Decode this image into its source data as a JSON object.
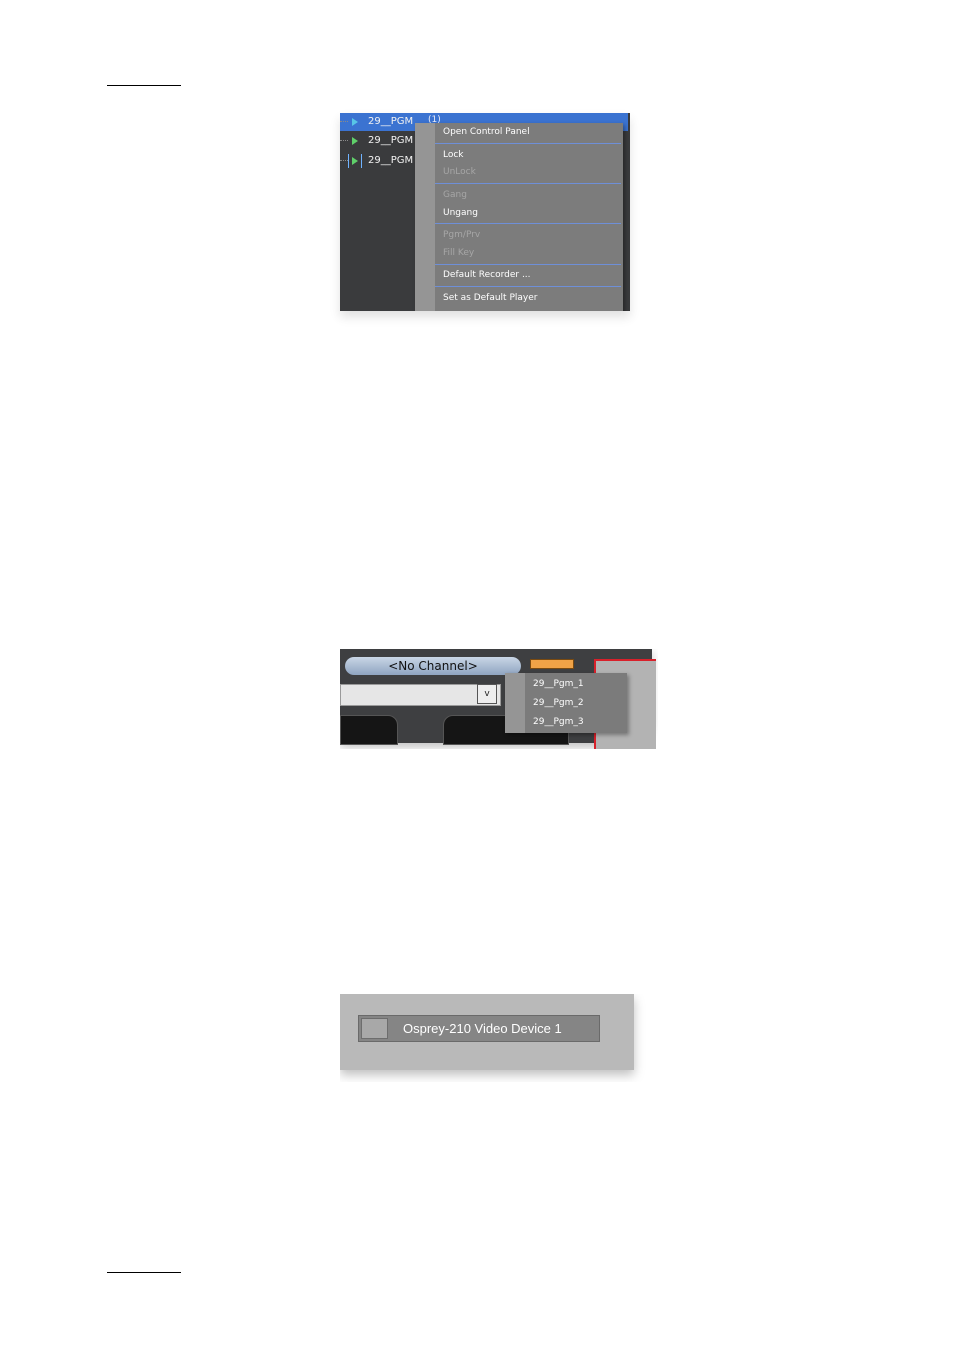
{
  "figure1": {
    "channels": [
      {
        "label": "29__PGM",
        "icon": "play-icon",
        "selected": true
      },
      {
        "label": "29__PGM",
        "icon": "play-icon",
        "selected": false
      },
      {
        "label": "29__PGM",
        "icon": "bracketed-play-icon",
        "selected": false
      }
    ],
    "overflow_text": "(1)",
    "menu": {
      "items": [
        {
          "label": "Open Control Panel",
          "enabled": true
        },
        {
          "label": "Lock",
          "enabled": true
        },
        {
          "label": "UnLock",
          "enabled": false
        },
        {
          "label": "Gang",
          "enabled": false
        },
        {
          "label": "Ungang",
          "enabled": true
        },
        {
          "label": "Pgm/Prv",
          "enabled": false
        },
        {
          "label": "Fill Key",
          "enabled": false
        },
        {
          "label": "Default Recorder ...",
          "enabled": true
        },
        {
          "label": "Set as Default Player",
          "enabled": true
        }
      ]
    }
  },
  "figure2": {
    "channel_label": "<No Channel>",
    "dropdown_button": "v",
    "options": [
      "29__Pgm_1",
      "29__Pgm_2",
      "29__Pgm_3"
    ]
  },
  "figure3": {
    "device_name": "Osprey-210 Video Device 1"
  },
  "colors": {
    "selection_blue": "#3b73d1",
    "menu_grey": "#7c7c7c",
    "accent_orange": "#f0a347",
    "accent_red": "#d8202a"
  }
}
